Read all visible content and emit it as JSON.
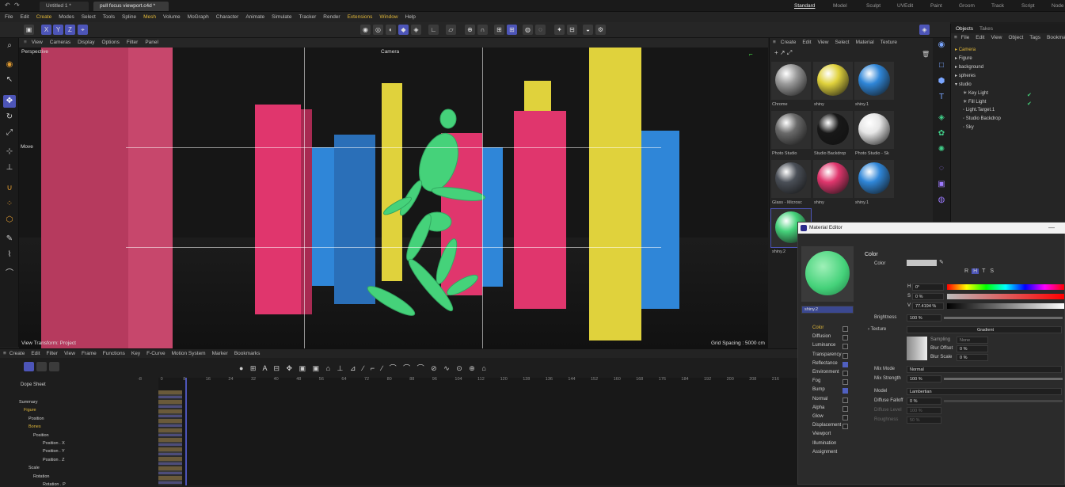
{
  "window": {
    "tabs": [
      "Untitled 1 *",
      "pull focus viewport.c4d *"
    ],
    "layouts": [
      "Standard",
      "Model",
      "Sculpt",
      "UVEdit",
      "Paint",
      "Groom",
      "Track",
      "Script",
      "Node"
    ]
  },
  "menubar": [
    "File",
    "Edit",
    "Create",
    "Modes",
    "Select",
    "Tools",
    "Spline",
    "Mesh",
    "Volume",
    "MoGraph",
    "Character",
    "Animate",
    "Simulate",
    "Tracker",
    "Render",
    "Extensions",
    "Window",
    "Help"
  ],
  "axis_buttons": [
    "X",
    "Y",
    "Z"
  ],
  "viewport": {
    "menu": [
      "View",
      "Cameras",
      "Display",
      "Options",
      "Filter",
      "Panel"
    ],
    "label_perspective": "Perspective",
    "label_camera": "Camera",
    "label_move": "Move",
    "label_transform": "View Transform: Project",
    "label_grid": "Grid Spacing : 5000 cm"
  },
  "material_manager": {
    "menu": [
      "Create",
      "Edit",
      "View",
      "Select",
      "Material",
      "Texture"
    ],
    "materials": [
      {
        "name": "Chrome",
        "color": "#9a9a9a"
      },
      {
        "name": "shiny",
        "color": "#e0d23c"
      },
      {
        "name": "shiny.1",
        "color": "#2f86d8"
      },
      {
        "name": "Photo Studio",
        "color": "#6a6a6a"
      },
      {
        "name": "Studio Backdrop",
        "color": "#181818"
      },
      {
        "name": "Photo Studio - Sk",
        "color": "#e6e6e6"
      },
      {
        "name": "Glass - Microsc",
        "color": "#4a4f57"
      },
      {
        "name": "shiny",
        "color": "#e0366d"
      },
      {
        "name": "shiny.1",
        "color": "#2f86d8"
      },
      {
        "name": "shiny.2",
        "color": "#45d27a"
      }
    ]
  },
  "objects": {
    "tabs": [
      "Objects",
      "Takes"
    ],
    "menu": [
      "File",
      "Edit",
      "View",
      "Object",
      "Tags",
      "Bookmarks"
    ],
    "items": [
      "Camera",
      "Figure",
      "background",
      "spheres",
      "studio",
      "Key Light",
      "Fill Light",
      "Light.Target.1",
      "Studio Backdrop",
      "Sky"
    ]
  },
  "material_editor": {
    "title": "Material Editor",
    "name_field": "shiny.2",
    "section": "Color",
    "channels": [
      "Color",
      "Diffusion",
      "Luminance",
      "Transparency",
      "Reflectance",
      "Environment",
      "Fog",
      "Bump",
      "Normal",
      "Alpha",
      "Glow",
      "Displacement",
      "Viewport",
      "Illumination",
      "Assignment"
    ],
    "channels_checked": [
      false,
      false,
      false,
      false,
      true,
      false,
      false,
      true,
      false,
      false,
      false,
      false
    ],
    "color_label": "Color",
    "mode_buttons": [
      "R",
      "H",
      "T",
      "S"
    ],
    "h_value": "0°",
    "s_value": "0 %",
    "v_value": "77.4194 %",
    "brightness_label": "Brightness",
    "brightness_value": "100 %",
    "brightness_fill": 1.0,
    "texture_label": "Texture",
    "texture_value": "Gradient",
    "sampling_label": "Sampling",
    "sampling_value": "None",
    "blur_offset_label": "Blur Offset",
    "blur_offset_value": "0 %",
    "blur_scale_label": "Blur Scale",
    "blur_scale_value": "0 %",
    "mix_mode_label": "Mix Mode",
    "mix_mode_value": "Normal",
    "mix_strength_label": "Mix Strength",
    "mix_strength_value": "100 %",
    "model_label": "Model",
    "model_value": "Lambertian",
    "diffuse_falloff_label": "Diffuse Falloff",
    "diffuse_falloff_value": "0 %",
    "diffuse_level_label": "Diffuse Level",
    "diffuse_level_value": "100 %",
    "roughness_label": "Roughness",
    "roughness_value": "50 %"
  },
  "timeline": {
    "menu": [
      "View",
      "Create",
      "Edit",
      "Filter",
      "View",
      "Frame",
      "Functions",
      "Key",
      "F-Curve",
      "Motion System",
      "Marker",
      "Bookmarks"
    ],
    "label": "Dope Sheet",
    "ticks": [
      "-8",
      "0",
      "8",
      "16",
      "24",
      "32",
      "40",
      "48",
      "56",
      "64",
      "72",
      "80",
      "88",
      "96",
      "104",
      "112",
      "120",
      "128",
      "136",
      "144",
      "152",
      "160",
      "168",
      "176",
      "184",
      "192",
      "200",
      "208",
      "216"
    ],
    "tracks": [
      "Summary",
      "Figure",
      "Position",
      "Bones",
      "Position",
      "Position . X",
      "Position . Y",
      "Position . Z",
      "Scale",
      "Rotation",
      "Rotation . P"
    ]
  },
  "colors": {
    "accent": "#4d55b8",
    "pink": "#e0366d",
    "blue": "#2f86d8",
    "yellow": "#e0d23c",
    "figure": "#45d27a"
  }
}
